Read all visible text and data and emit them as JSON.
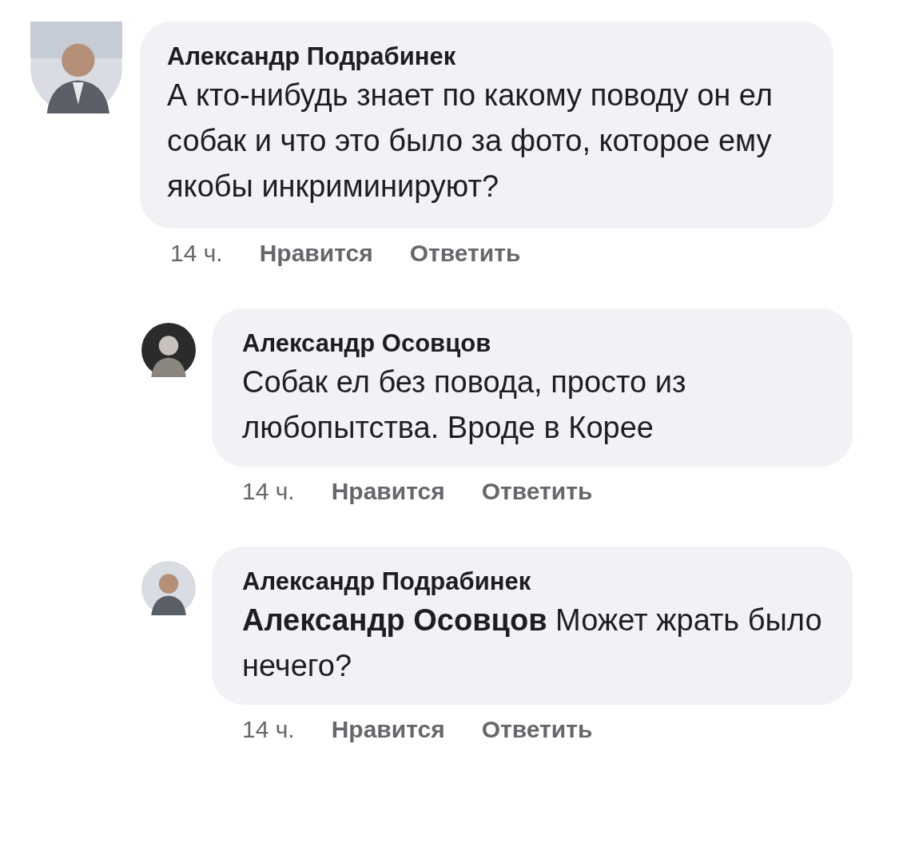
{
  "comments": [
    {
      "author": "Александр Подрабинек",
      "text": "А кто-нибудь знает по какому поводу он ел собак и что это было за фото, которое ему якобы инкриминируют?",
      "time": "14 ч.",
      "like": "Нравится",
      "reply": "Ответить",
      "replies": [
        {
          "author": "Александр Осовцов",
          "text": "Собак ел без повода, просто из любопытства. Вроде в Корее",
          "time": "14 ч.",
          "like": "Нравится",
          "reply": "Ответить"
        },
        {
          "author": "Александр Подрабинек",
          "text": "**Александр Осовцов** Может жрать было нечего?",
          "time": "14 ч.",
          "like": "Нравится",
          "reply": "Ответить"
        }
      ]
    }
  ]
}
